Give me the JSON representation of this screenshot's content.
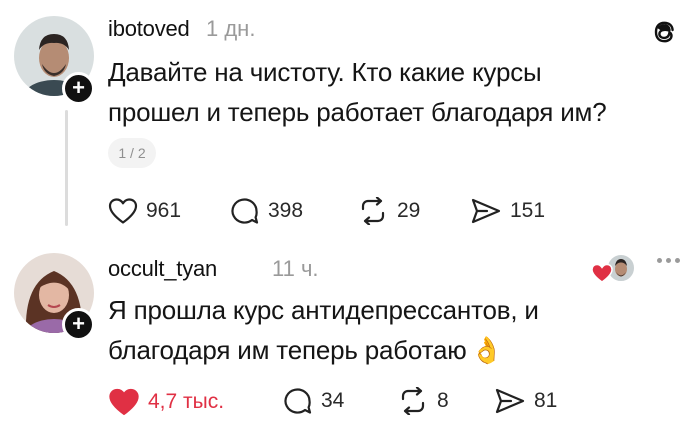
{
  "post": {
    "username": "ibotoved",
    "time": "1 дн.",
    "text_line1": "Давайте на чистоту. Кто какие курсы",
    "text_line2": "прошел и теперь работает благодаря им?",
    "page_indicator": "1 / 2",
    "likes": "961",
    "comments": "398",
    "reposts": "29",
    "shares": "151"
  },
  "reply": {
    "username": "occult_tyan",
    "time": "11 ч.",
    "text_line1": "Я прошла курс антидепрессантов, и",
    "text_line2": "благодаря им теперь работаю",
    "emoji": "👌",
    "likes": "4,7 тыс.",
    "comments": "34",
    "reposts": "8",
    "shares": "81"
  },
  "icons": {
    "app_logo": "threads-icon",
    "more": "more-icon",
    "like": "heart-icon",
    "comment": "comment-icon",
    "repost": "repost-icon",
    "share": "share-icon"
  },
  "colors": {
    "liked": "#e03044",
    "muted": "#9a9a9a",
    "text": "#151515"
  }
}
